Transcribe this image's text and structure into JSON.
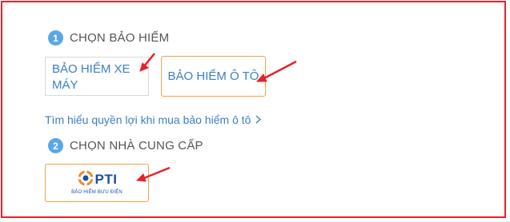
{
  "colors": {
    "frame": "#e8212a",
    "accent_blue": "#3b7fc4",
    "step_badge": "#5aa7e6",
    "selected_border": "#f3a24a",
    "arrow": "#e8212a"
  },
  "step1": {
    "number": "1",
    "title": "CHỌN BẢO HIỂM",
    "options": [
      {
        "label": "BẢO HIỂM XE MÁY",
        "selected": false
      },
      {
        "label": "BẢO HIỂM Ô TÔ",
        "selected": true
      }
    ],
    "benefit_link": "Tìm hiểu quyền lợi khi mua bảo hiểm ô tô"
  },
  "step2": {
    "number": "2",
    "title": "CHỌN NHÀ CUNG CẤP",
    "provider": {
      "logo_text": "PTI",
      "subtitle": "BẢO HIỂM BƯU ĐIỆN",
      "icon": "pti-logo-icon"
    }
  }
}
